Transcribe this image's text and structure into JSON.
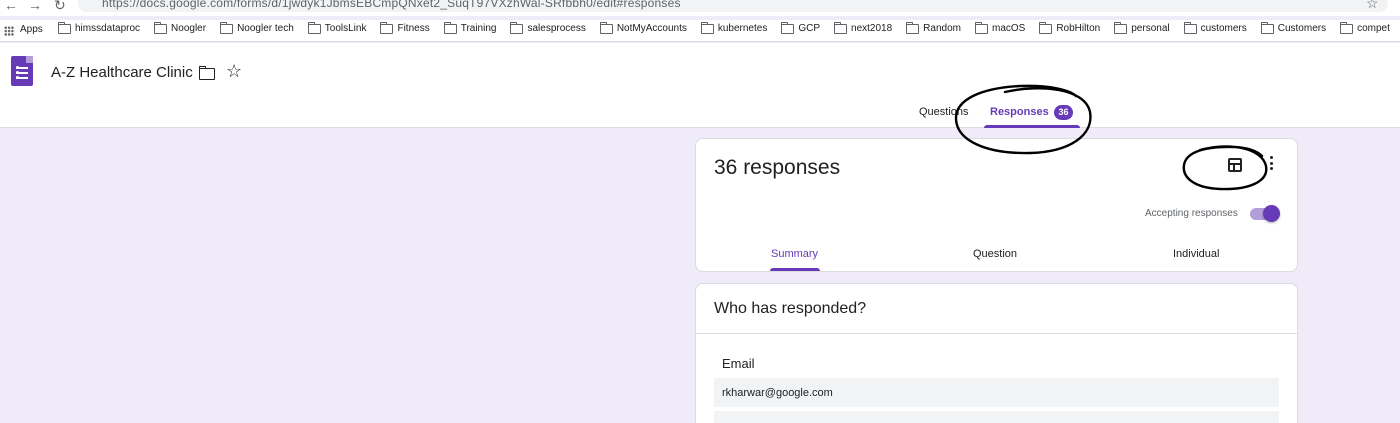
{
  "browser": {
    "url": "https://docs.google.com/forms/d/1jwdyk1JbmsEBCmpQNxet2_SuqT97VXzhWal-SRfbbh0/edit#responses",
    "apps_label": "Apps",
    "bookmarks": [
      "himssdataproc",
      "Noogler",
      "Noogler tech",
      "ToolsLink",
      "Fitness",
      "Training",
      "salesprocess",
      "NotMyAccounts",
      "kubernetes",
      "GCP",
      "next2018",
      "Random",
      "macOS",
      "RobHilton",
      "personal",
      "customers",
      "Customers",
      "compet"
    ]
  },
  "header": {
    "form_title": "A-Z Healthcare Clinic",
    "tabs": {
      "questions": "Questions",
      "responses": "Responses",
      "responses_count": "36"
    }
  },
  "summary_card": {
    "response_count_text": "36 responses",
    "accepting_label": "Accepting responses",
    "accepting_on": true,
    "subtabs": [
      "Summary",
      "Question",
      "Individual"
    ]
  },
  "who_card": {
    "title": "Who has responded?",
    "email_label": "Email",
    "emails": [
      "rkharwar@google.com"
    ]
  },
  "colors": {
    "accent": "#673ab7",
    "background": "#f0ebf8",
    "annotation_ink": "#000000"
  },
  "icons": [
    "back-icon",
    "forward-icon",
    "reload-icon",
    "apps-icon",
    "folder-icon",
    "star-icon",
    "forms-logo",
    "sheets-icon",
    "more-vert-icon"
  ]
}
